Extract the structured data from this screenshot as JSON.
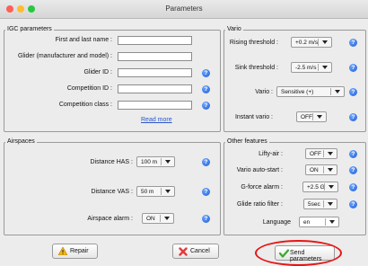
{
  "window": {
    "title": "Parameters"
  },
  "igc": {
    "legend": "IGC parameters",
    "fields": [
      {
        "label": "First and last name :",
        "value": ""
      },
      {
        "label": "Glider (manufacturer and model) :",
        "value": ""
      },
      {
        "label": "Glider ID :",
        "value": ""
      },
      {
        "label": "Competition ID :",
        "value": ""
      },
      {
        "label": "Competition class :",
        "value": ""
      }
    ],
    "read_more": "Read more"
  },
  "vario": {
    "legend": "Vario",
    "rising_threshold": {
      "label": "Rising threshold :",
      "value": "+0.2 m/s"
    },
    "sink_threshold": {
      "label": "Sink threshold :",
      "value": "-2.5 m/s"
    },
    "vario": {
      "label": "Vario :",
      "value": "Sensitive (+)"
    },
    "instant_vario": {
      "label": "Instant vario :",
      "value": "OFF"
    }
  },
  "airspaces": {
    "legend": "Airspaces",
    "distance_has": {
      "label": "Distance HAS :",
      "value": "100 m"
    },
    "distance_vas": {
      "label": "Distance VAS :",
      "value": "50 m"
    },
    "airspace_alarm": {
      "label": "Airspace alarm :",
      "value": "ON"
    }
  },
  "other": {
    "legend": "Other features",
    "lifty_air": {
      "label": "Lifty-air :",
      "value": "OFF"
    },
    "vario_autostart": {
      "label": "Vario auto-start :",
      "value": "ON"
    },
    "gforce_alarm": {
      "label": "G-force alarm :",
      "value": "+2.5 G"
    },
    "glide_ratio_filter": {
      "label": "Glide ratio filter :",
      "value": "5sec"
    },
    "language": {
      "label": "Language",
      "value": "en"
    }
  },
  "buttons": {
    "repair": "Repair",
    "cancel": "Cancel",
    "send": "Send parameters"
  },
  "help_glyph": "?",
  "colors": {
    "help": "#2a6ae0",
    "highlight_oval": "#e51616",
    "link": "#2a55c9"
  }
}
